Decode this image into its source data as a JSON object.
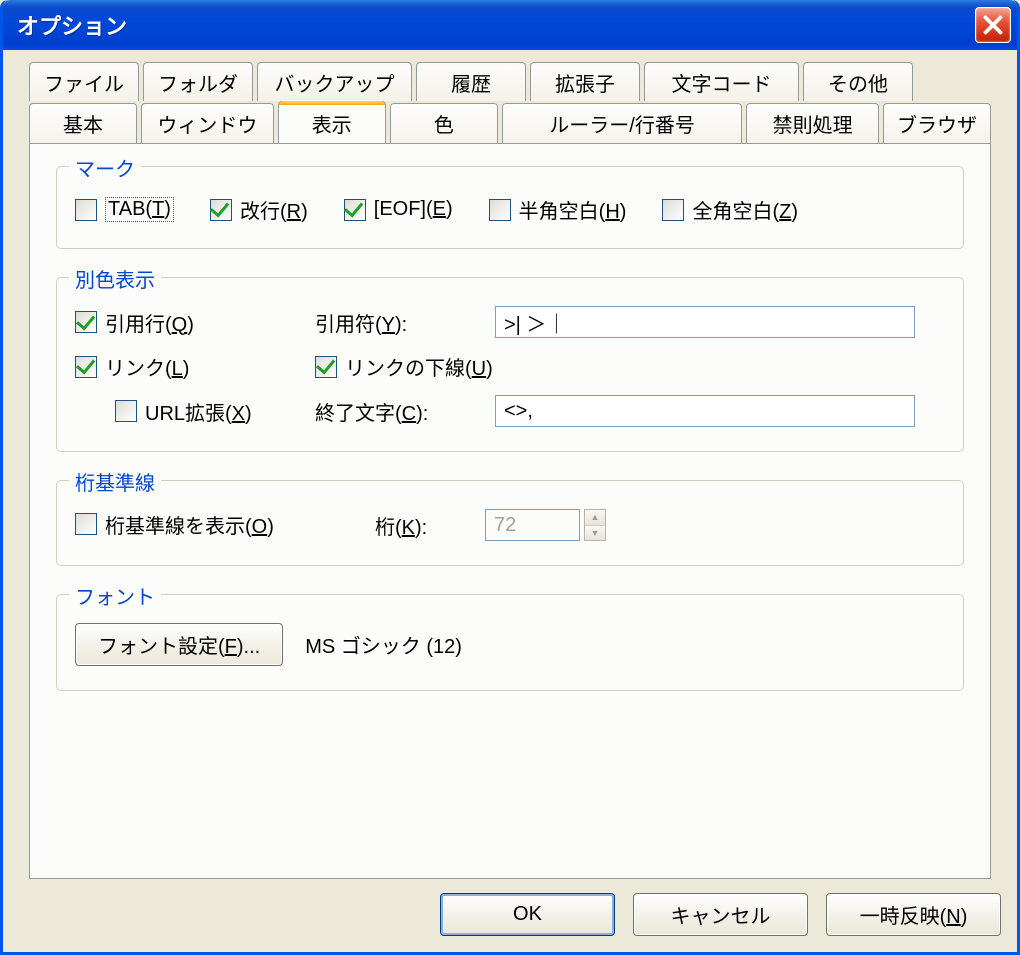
{
  "title": "オプション",
  "tabs_row1": [
    "ファイル",
    "フォルダ",
    "バックアップ",
    "履歴",
    "拡張子",
    "文字コード",
    "その他"
  ],
  "tabs_row2": [
    "基本",
    "ウィンドウ",
    "表示",
    "色",
    "ルーラー/行番号",
    "禁則処理",
    "ブラウザ"
  ],
  "active_tab": "表示",
  "group_mark": {
    "legend": "マーク",
    "tab": {
      "label": "TAB(T)",
      "checked": false,
      "focused": true
    },
    "newline": {
      "label": "改行(R)",
      "checked": true
    },
    "eof": {
      "label": "[EOF](E)",
      "checked": true
    },
    "half_space": {
      "label": "半角空白(H)",
      "checked": false
    },
    "full_space": {
      "label": "全角空白(Z)",
      "checked": false
    }
  },
  "group_color": {
    "legend": "別色表示",
    "quote_line": {
      "label": "引用行(Q)",
      "checked": true
    },
    "quote_char_label": "引用符(Y):",
    "quote_char_value": ">| ＞｜",
    "link": {
      "label": "リンク(L)",
      "checked": true
    },
    "link_underline": {
      "label": "リンクの下線(U)",
      "checked": true
    },
    "url_ext": {
      "label": "URL拡張(X)",
      "checked": false
    },
    "end_char_label": "終了文字(C):",
    "end_char_value": "<>,"
  },
  "group_column": {
    "legend": "桁基準線",
    "show": {
      "label": "桁基準線を表示(O)",
      "checked": false
    },
    "col_label": "桁(K):",
    "col_value": "72"
  },
  "group_font": {
    "legend": "フォント",
    "button": "フォント設定(F)...",
    "info": "MS ゴシック (12)"
  },
  "buttons": {
    "ok": "OK",
    "cancel": "キャンセル",
    "apply": "一時反映(N)"
  }
}
